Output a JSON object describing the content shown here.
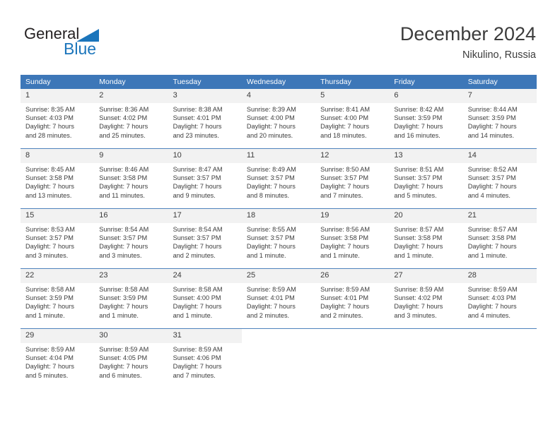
{
  "brand": {
    "name_top": "General",
    "name_bottom": "Blue",
    "triangle_color": "#1b75bb",
    "icon": "triangle-icon"
  },
  "header": {
    "title": "December 2024",
    "subtitle": "Nikulino, Russia"
  },
  "colors": {
    "header_blue": "#3d77b8",
    "row_divider": "#4f82bd",
    "day_band": "#f2f2f2",
    "text": "#3c3c3c"
  },
  "calendar": {
    "weekdays": [
      "Sunday",
      "Monday",
      "Tuesday",
      "Wednesday",
      "Thursday",
      "Friday",
      "Saturday"
    ],
    "weeks": [
      [
        {
          "day": "1",
          "sunrise": "Sunrise: 8:35 AM",
          "sunset": "Sunset: 4:03 PM",
          "daylight_1": "Daylight: 7 hours",
          "daylight_2": "and 28 minutes."
        },
        {
          "day": "2",
          "sunrise": "Sunrise: 8:36 AM",
          "sunset": "Sunset: 4:02 PM",
          "daylight_1": "Daylight: 7 hours",
          "daylight_2": "and 25 minutes."
        },
        {
          "day": "3",
          "sunrise": "Sunrise: 8:38 AM",
          "sunset": "Sunset: 4:01 PM",
          "daylight_1": "Daylight: 7 hours",
          "daylight_2": "and 23 minutes."
        },
        {
          "day": "4",
          "sunrise": "Sunrise: 8:39 AM",
          "sunset": "Sunset: 4:00 PM",
          "daylight_1": "Daylight: 7 hours",
          "daylight_2": "and 20 minutes."
        },
        {
          "day": "5",
          "sunrise": "Sunrise: 8:41 AM",
          "sunset": "Sunset: 4:00 PM",
          "daylight_1": "Daylight: 7 hours",
          "daylight_2": "and 18 minutes."
        },
        {
          "day": "6",
          "sunrise": "Sunrise: 8:42 AM",
          "sunset": "Sunset: 3:59 PM",
          "daylight_1": "Daylight: 7 hours",
          "daylight_2": "and 16 minutes."
        },
        {
          "day": "7",
          "sunrise": "Sunrise: 8:44 AM",
          "sunset": "Sunset: 3:59 PM",
          "daylight_1": "Daylight: 7 hours",
          "daylight_2": "and 14 minutes."
        }
      ],
      [
        {
          "day": "8",
          "sunrise": "Sunrise: 8:45 AM",
          "sunset": "Sunset: 3:58 PM",
          "daylight_1": "Daylight: 7 hours",
          "daylight_2": "and 13 minutes."
        },
        {
          "day": "9",
          "sunrise": "Sunrise: 8:46 AM",
          "sunset": "Sunset: 3:58 PM",
          "daylight_1": "Daylight: 7 hours",
          "daylight_2": "and 11 minutes."
        },
        {
          "day": "10",
          "sunrise": "Sunrise: 8:47 AM",
          "sunset": "Sunset: 3:57 PM",
          "daylight_1": "Daylight: 7 hours",
          "daylight_2": "and 9 minutes."
        },
        {
          "day": "11",
          "sunrise": "Sunrise: 8:49 AM",
          "sunset": "Sunset: 3:57 PM",
          "daylight_1": "Daylight: 7 hours",
          "daylight_2": "and 8 minutes."
        },
        {
          "day": "12",
          "sunrise": "Sunrise: 8:50 AM",
          "sunset": "Sunset: 3:57 PM",
          "daylight_1": "Daylight: 7 hours",
          "daylight_2": "and 7 minutes."
        },
        {
          "day": "13",
          "sunrise": "Sunrise: 8:51 AM",
          "sunset": "Sunset: 3:57 PM",
          "daylight_1": "Daylight: 7 hours",
          "daylight_2": "and 5 minutes."
        },
        {
          "day": "14",
          "sunrise": "Sunrise: 8:52 AM",
          "sunset": "Sunset: 3:57 PM",
          "daylight_1": "Daylight: 7 hours",
          "daylight_2": "and 4 minutes."
        }
      ],
      [
        {
          "day": "15",
          "sunrise": "Sunrise: 8:53 AM",
          "sunset": "Sunset: 3:57 PM",
          "daylight_1": "Daylight: 7 hours",
          "daylight_2": "and 3 minutes."
        },
        {
          "day": "16",
          "sunrise": "Sunrise: 8:54 AM",
          "sunset": "Sunset: 3:57 PM",
          "daylight_1": "Daylight: 7 hours",
          "daylight_2": "and 3 minutes."
        },
        {
          "day": "17",
          "sunrise": "Sunrise: 8:54 AM",
          "sunset": "Sunset: 3:57 PM",
          "daylight_1": "Daylight: 7 hours",
          "daylight_2": "and 2 minutes."
        },
        {
          "day": "18",
          "sunrise": "Sunrise: 8:55 AM",
          "sunset": "Sunset: 3:57 PM",
          "daylight_1": "Daylight: 7 hours",
          "daylight_2": "and 1 minute."
        },
        {
          "day": "19",
          "sunrise": "Sunrise: 8:56 AM",
          "sunset": "Sunset: 3:58 PM",
          "daylight_1": "Daylight: 7 hours",
          "daylight_2": "and 1 minute."
        },
        {
          "day": "20",
          "sunrise": "Sunrise: 8:57 AM",
          "sunset": "Sunset: 3:58 PM",
          "daylight_1": "Daylight: 7 hours",
          "daylight_2": "and 1 minute."
        },
        {
          "day": "21",
          "sunrise": "Sunrise: 8:57 AM",
          "sunset": "Sunset: 3:58 PM",
          "daylight_1": "Daylight: 7 hours",
          "daylight_2": "and 1 minute."
        }
      ],
      [
        {
          "day": "22",
          "sunrise": "Sunrise: 8:58 AM",
          "sunset": "Sunset: 3:59 PM",
          "daylight_1": "Daylight: 7 hours",
          "daylight_2": "and 1 minute."
        },
        {
          "day": "23",
          "sunrise": "Sunrise: 8:58 AM",
          "sunset": "Sunset: 3:59 PM",
          "daylight_1": "Daylight: 7 hours",
          "daylight_2": "and 1 minute."
        },
        {
          "day": "24",
          "sunrise": "Sunrise: 8:58 AM",
          "sunset": "Sunset: 4:00 PM",
          "daylight_1": "Daylight: 7 hours",
          "daylight_2": "and 1 minute."
        },
        {
          "day": "25",
          "sunrise": "Sunrise: 8:59 AM",
          "sunset": "Sunset: 4:01 PM",
          "daylight_1": "Daylight: 7 hours",
          "daylight_2": "and 2 minutes."
        },
        {
          "day": "26",
          "sunrise": "Sunrise: 8:59 AM",
          "sunset": "Sunset: 4:01 PM",
          "daylight_1": "Daylight: 7 hours",
          "daylight_2": "and 2 minutes."
        },
        {
          "day": "27",
          "sunrise": "Sunrise: 8:59 AM",
          "sunset": "Sunset: 4:02 PM",
          "daylight_1": "Daylight: 7 hours",
          "daylight_2": "and 3 minutes."
        },
        {
          "day": "28",
          "sunrise": "Sunrise: 8:59 AM",
          "sunset": "Sunset: 4:03 PM",
          "daylight_1": "Daylight: 7 hours",
          "daylight_2": "and 4 minutes."
        }
      ],
      [
        {
          "day": "29",
          "sunrise": "Sunrise: 8:59 AM",
          "sunset": "Sunset: 4:04 PM",
          "daylight_1": "Daylight: 7 hours",
          "daylight_2": "and 5 minutes."
        },
        {
          "day": "30",
          "sunrise": "Sunrise: 8:59 AM",
          "sunset": "Sunset: 4:05 PM",
          "daylight_1": "Daylight: 7 hours",
          "daylight_2": "and 6 minutes."
        },
        {
          "day": "31",
          "sunrise": "Sunrise: 8:59 AM",
          "sunset": "Sunset: 4:06 PM",
          "daylight_1": "Daylight: 7 hours",
          "daylight_2": "and 7 minutes."
        },
        {
          "day": "",
          "sunrise": "",
          "sunset": "",
          "daylight_1": "",
          "daylight_2": ""
        },
        {
          "day": "",
          "sunrise": "",
          "sunset": "",
          "daylight_1": "",
          "daylight_2": ""
        },
        {
          "day": "",
          "sunrise": "",
          "sunset": "",
          "daylight_1": "",
          "daylight_2": ""
        },
        {
          "day": "",
          "sunrise": "",
          "sunset": "",
          "daylight_1": "",
          "daylight_2": ""
        }
      ]
    ]
  }
}
